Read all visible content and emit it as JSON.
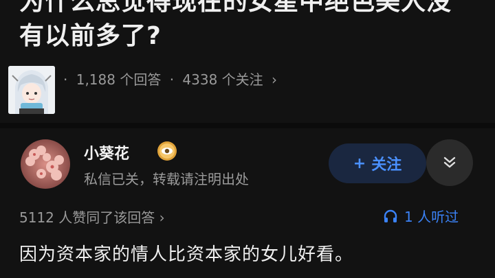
{
  "question": {
    "line1": "为什么总觉得现在的女星中绝色美人没",
    "line2": "有以前多了?"
  },
  "meta": {
    "answers": "1,188 个回答",
    "follows": "4338 个关注",
    "separator": "·",
    "chevron": "›"
  },
  "author": {
    "name": "小葵花",
    "bio": "私信已关，转载请注明出处",
    "badge_icon": "verified-eye-icon"
  },
  "follow_button": {
    "plus": "+",
    "label": "关注"
  },
  "stats": {
    "likes": "5112 人赞同了该回答",
    "chevron": "›",
    "listeners": "1 人听过"
  },
  "answer": {
    "text": "因为资本家的情人比资本家的女儿好看。"
  },
  "colors": {
    "background": "#121212",
    "accent": "#3b82f6",
    "follow_bg": "#1a2740"
  }
}
